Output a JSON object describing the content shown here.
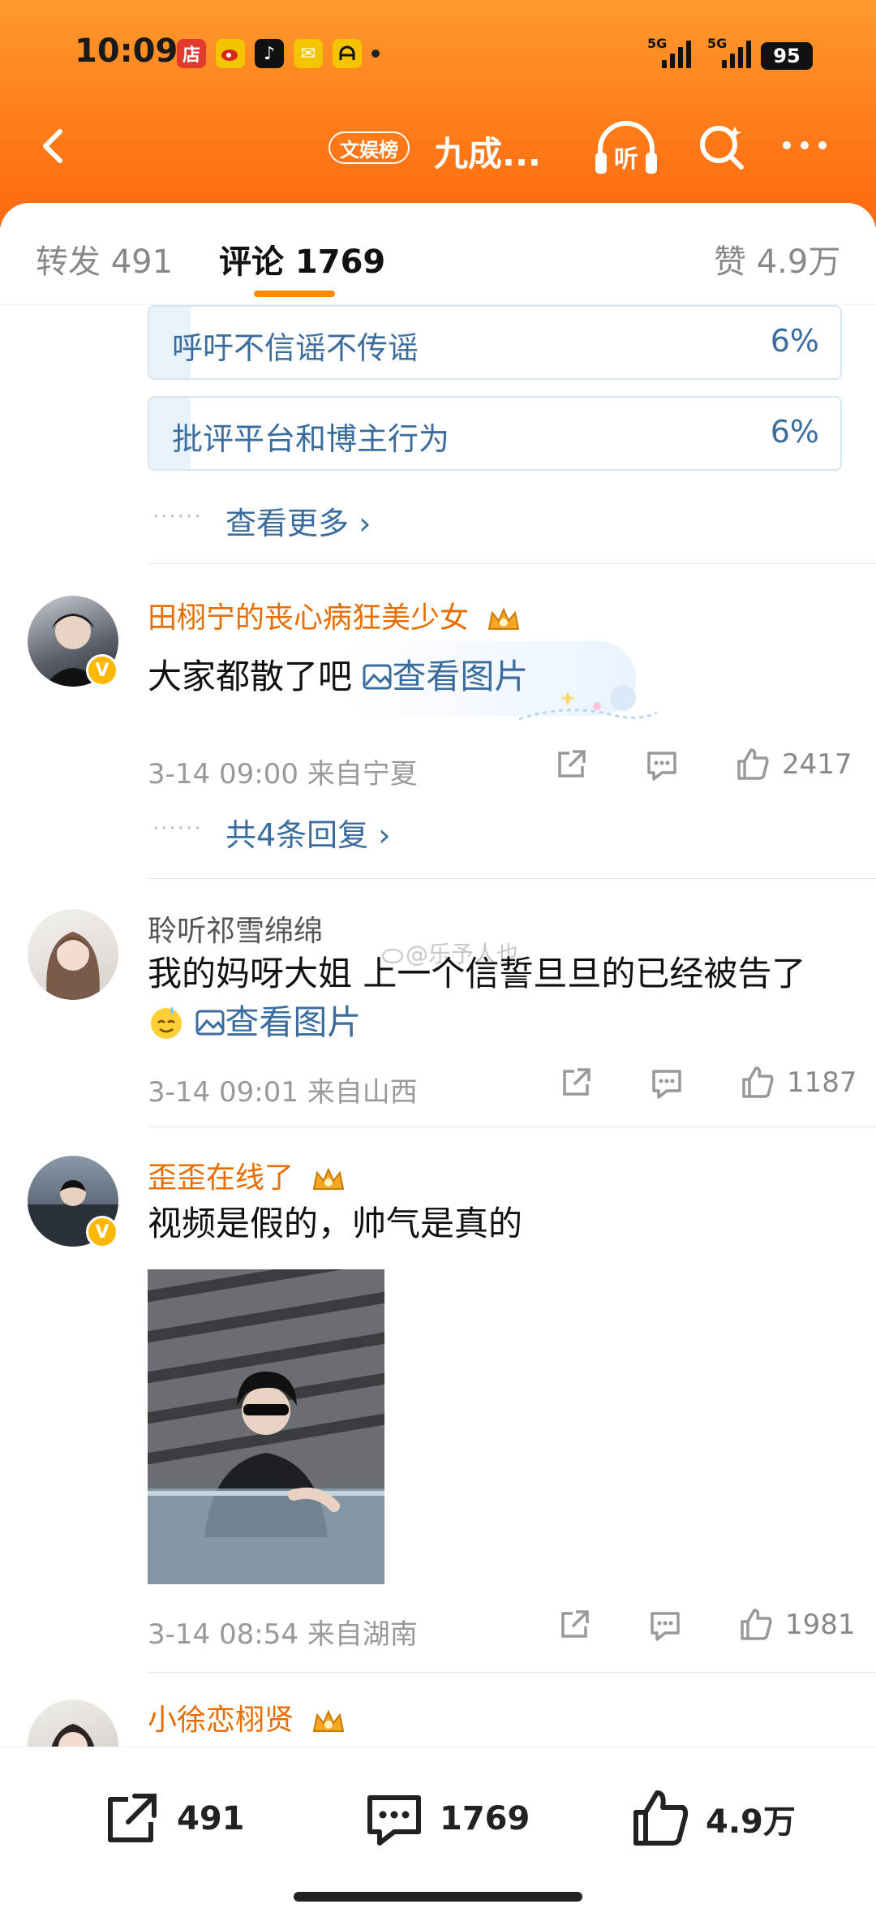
{
  "status": {
    "time": "10:09",
    "sig1": "5G",
    "sig2": "5G",
    "battery": "95"
  },
  "nav": {
    "rank_badge": "文娱榜",
    "title": "九成..."
  },
  "tabs": {
    "repost": "转发 491",
    "comments": "评论 1769",
    "likes": "赞 4.9万"
  },
  "poll": [
    {
      "label": "呼吁不信谣不传谣",
      "percent": "6%",
      "fraction": 0.06
    },
    {
      "label": "批评平台和博主行为",
      "percent": "6%",
      "fraction": 0.06
    }
  ],
  "poll_more": "查看更多 ›",
  "comments": [
    {
      "user": "田栩宁的丧心病狂美少女",
      "text": "大家都散了吧",
      "image_link": "查看图片",
      "time": "3-14 09:00",
      "from": "来自宁夏",
      "likes": "2417",
      "replies": "共4条回复 ›"
    },
    {
      "user": "聆听祁雪绵绵",
      "text": "我的妈呀大姐 上一个信誓旦旦的已经被告了",
      "image_link": "查看图片",
      "time": "3-14 09:01",
      "from": "来自山西",
      "likes": "1187",
      "watermark": "@乐予人也"
    },
    {
      "user": "歪歪在线了",
      "text": "视频是假的，帅气是真的",
      "time": "3-14 08:54",
      "from": "来自湖南",
      "likes": "1981"
    },
    {
      "user": "小徐恋栩贤"
    }
  ],
  "bottom": {
    "repost": "491",
    "comments": "1769",
    "likes": "4.9万"
  }
}
